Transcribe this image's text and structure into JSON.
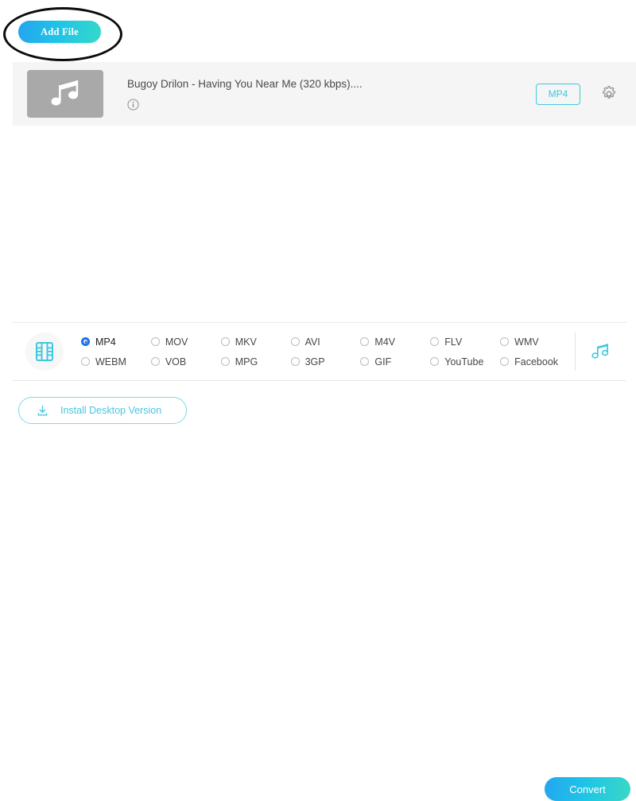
{
  "colors": {
    "accent_cyan": "#3ec8e0",
    "accent_blue": "#23a4ef",
    "radio_selected": "#1a73e8",
    "row_background": "#f5f5f5",
    "thumbnail_gray": "#a9a9a9",
    "annotation": "#0b0b0b"
  },
  "toolbar": {
    "add_file_label": "Add File"
  },
  "file_item": {
    "thumbnail_icon": "music-note-icon",
    "title": "Bugoy Drilon - Having You Near Me (320 kbps)....",
    "info_icon": "info-icon",
    "format_tag": "MP4",
    "settings_icon": "gear-icon"
  },
  "format_panel": {
    "video_icon": "film-strip-icon",
    "audio_icon": "music-note-icon",
    "selected": "MP4",
    "options": [
      {
        "label": "MP4",
        "selected": true
      },
      {
        "label": "MOV",
        "selected": false
      },
      {
        "label": "MKV",
        "selected": false
      },
      {
        "label": "AVI",
        "selected": false
      },
      {
        "label": "M4V",
        "selected": false
      },
      {
        "label": "FLV",
        "selected": false
      },
      {
        "label": "WMV",
        "selected": false
      },
      {
        "label": "WEBM",
        "selected": false
      },
      {
        "label": "VOB",
        "selected": false
      },
      {
        "label": "MPG",
        "selected": false
      },
      {
        "label": "3GP",
        "selected": false
      },
      {
        "label": "GIF",
        "selected": false
      },
      {
        "label": "YouTube",
        "selected": false
      },
      {
        "label": "Facebook",
        "selected": false
      }
    ]
  },
  "footer": {
    "install_label": "Install Desktop Version",
    "install_icon": "download-icon",
    "convert_label": "Convert"
  }
}
